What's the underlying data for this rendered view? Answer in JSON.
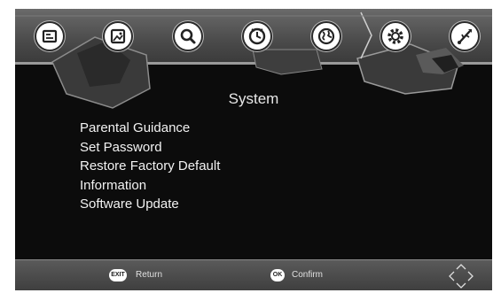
{
  "header": {
    "tabs": [
      {
        "icon": "tv-channel-icon"
      },
      {
        "icon": "picture-icon"
      },
      {
        "icon": "search-icon"
      },
      {
        "icon": "clock-icon"
      },
      {
        "icon": "language-globe-icon"
      },
      {
        "icon": "gear-icon",
        "selected": true
      },
      {
        "icon": "usb-icon"
      }
    ]
  },
  "page_title": "System",
  "menu": {
    "items": [
      "Parental Guidance",
      "Set Password",
      "Restore Factory Default",
      "Information",
      "Software Update"
    ]
  },
  "footer": {
    "exit_key": "EXIT",
    "exit_label": "Return",
    "ok_key": "OK",
    "ok_label": "Confirm"
  },
  "colors": {
    "background": "#0c0c0c",
    "bar": "#4a4a4a",
    "text": "#f2f2f2"
  }
}
